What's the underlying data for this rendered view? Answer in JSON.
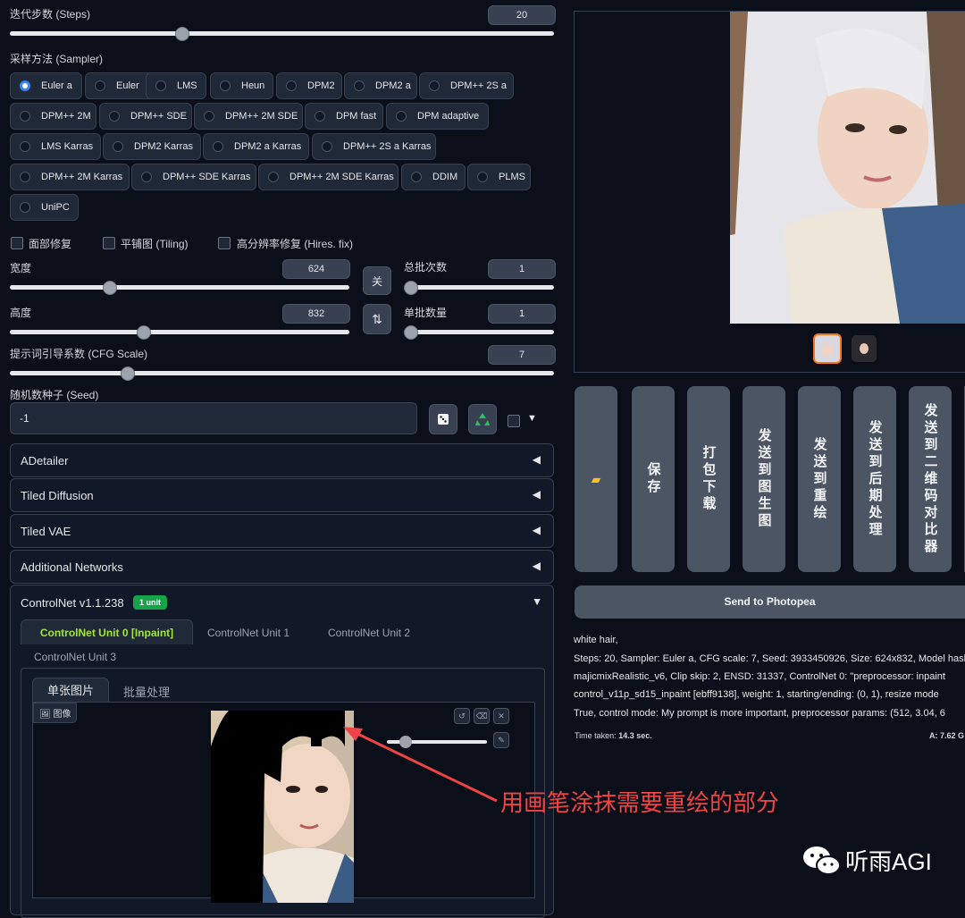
{
  "steps": {
    "label": "迭代步数 (Steps)",
    "value": "20",
    "level": 0.2
  },
  "sampler": {
    "label": "采样方法 (Sampler)",
    "selected": "Euler a",
    "options": [
      "Euler a",
      "Euler",
      "LMS",
      "Heun",
      "DPM2",
      "DPM2 a",
      "DPM++ 2S a",
      "DPM++ 2M",
      "DPM++ SDE",
      "DPM++ 2M SDE",
      "DPM fast",
      "DPM adaptive",
      "LMS Karras",
      "DPM2 Karras",
      "DPM2 a Karras",
      "DPM++ 2S a Karras",
      "DPM++ 2M Karras",
      "DPM++ SDE Karras",
      "DPM++ 2M SDE Karras",
      "DDIM",
      "PLMS",
      "UniPC"
    ]
  },
  "checks": {
    "face": "面部修复",
    "tiling": "平铺图 (Tiling)",
    "hires": "高分辨率修复 (Hires. fix)"
  },
  "width": {
    "label": "宽度",
    "value": "624",
    "level": 0.17
  },
  "height": {
    "label": "高度",
    "value": "832",
    "level": 0.25
  },
  "batch_count": {
    "label": "总批次数",
    "value": "1",
    "level": 0
  },
  "batch_size": {
    "label": "单批数量",
    "value": "1",
    "level": 0
  },
  "lock_icon": "关",
  "swap_icon": "⇅",
  "cfg": {
    "label": "提示词引导系数 (CFG Scale)",
    "value": "7",
    "level": 0.21
  },
  "seed": {
    "label": "随机数种子 (Seed)",
    "value": "-1"
  },
  "accordions": [
    "ADetailer",
    "Tiled Diffusion",
    "Tiled VAE",
    "Additional Networks"
  ],
  "controlnet": {
    "title": "ControlNet v1.1.238",
    "badge": "1 unit",
    "units": [
      "ControlNet Unit 0 [Inpaint]",
      "ControlNet Unit 1",
      "ControlNet Unit 2",
      "ControlNet Unit 3"
    ],
    "subtabs": [
      "单张图片",
      "批量处理"
    ],
    "image_label": "图像"
  },
  "annotation": "用画笔涂抹需要重绘的部分",
  "watermark": "听雨AGI",
  "action_buttons": [
    "保存",
    "打包下载",
    "发送到图生图",
    "发送到重绘",
    "发送到后期处理",
    "发送到二维码对比器"
  ],
  "photopea": "Send to Photopea",
  "info_lines": [
    "white hair,",
    "Steps: 20, Sampler: Euler a, CFG scale: 7, Seed: 3933450926, Size: 624x832, Model hash",
    "majicmixRealistic_v6, Clip skip: 2, ENSD: 31337, ControlNet 0: \"preprocessor: inpaint",
    "control_v11p_sd15_inpaint [ebff9138], weight: 1, starting/ending: (0, 1), resize mode",
    "True, control mode: My prompt is more important, preprocessor params: (512, 3.04, 6"
  ],
  "time_label": "Time taken:",
  "time_value": "14.3 sec.",
  "vram": "A: 7.62 G",
  "colors": {
    "accent": "#3b82f6",
    "badge": "#16a34a",
    "unit_active": "#a3e635",
    "thumb_border": "#f97316",
    "annotation": "#ef4444"
  }
}
